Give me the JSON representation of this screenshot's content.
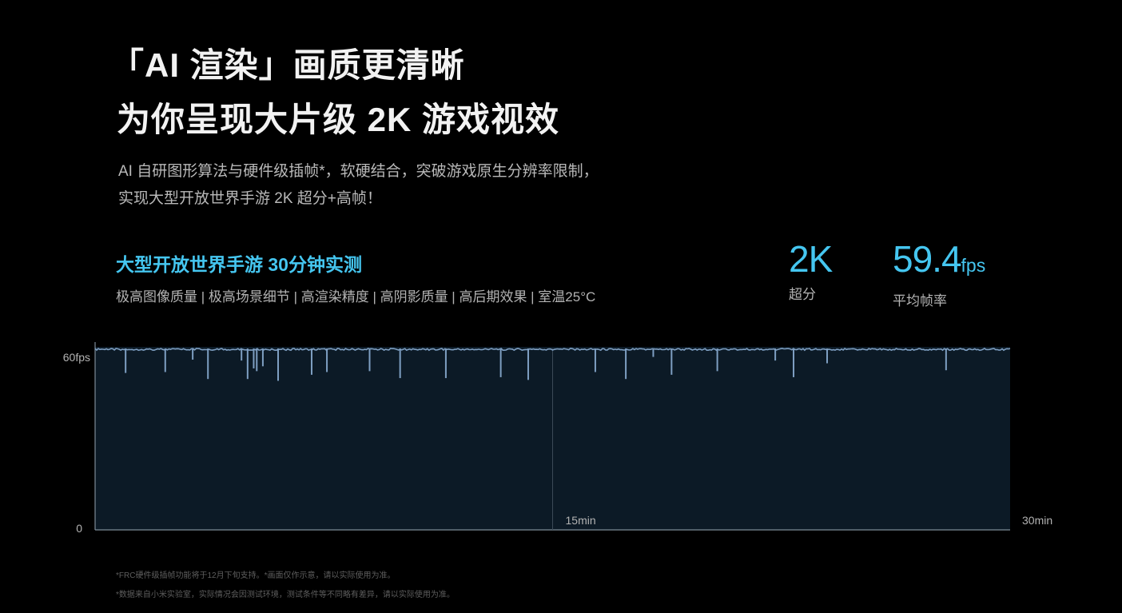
{
  "headline": {
    "line1": "「AI 渲染」画质更清晰",
    "line2": "为你呈现大片级 2K 游戏视效"
  },
  "subtitle": {
    "line1": "AI 自研图形算法与硬件级插帧*，软硬结合，突破游戏原生分辨率限制，",
    "line2": "实现大型开放世界手游 2K 超分+高帧！"
  },
  "test": {
    "title": "大型开放世界手游 30分钟实测",
    "settings": "极高图像质量 | 极高场景细节 | 高渲染精度 | 高阴影质量 | 高后期效果 | 室温25°C"
  },
  "stats": {
    "resolution": {
      "value": "2K",
      "label": "超分"
    },
    "fps": {
      "value": "59.4",
      "unit": "fps",
      "label": "平均帧率"
    }
  },
  "colors": {
    "accent": "#45c6f0",
    "plot_fill": "#0c1a26",
    "fps_line": "#7e9fc2"
  },
  "chart_data": {
    "type": "line",
    "xlabel": "",
    "ylabel": "",
    "x_range_min": [
      0,
      30
    ],
    "y_ticks": [
      "0",
      "60fps"
    ],
    "x_ticks": [
      {
        "value": 15,
        "label": "15min"
      },
      {
        "value": 30,
        "label": "30min"
      }
    ],
    "baseline_fps": 60,
    "dips": [
      {
        "t": 1.0,
        "fps": 51.9
      },
      {
        "t": 2.3,
        "fps": 52.2
      },
      {
        "t": 3.2,
        "fps": 56.3
      },
      {
        "t": 3.7,
        "fps": 49.9
      },
      {
        "t": 4.8,
        "fps": 56.0
      },
      {
        "t": 5.0,
        "fps": 49.9
      },
      {
        "t": 5.2,
        "fps": 53.4
      },
      {
        "t": 5.3,
        "fps": 52.5
      },
      {
        "t": 5.5,
        "fps": 54.1
      },
      {
        "t": 6.0,
        "fps": 49.3
      },
      {
        "t": 7.1,
        "fps": 51.3
      },
      {
        "t": 7.6,
        "fps": 52.2
      },
      {
        "t": 9.0,
        "fps": 52.5
      },
      {
        "t": 10.0,
        "fps": 50.2
      },
      {
        "t": 11.5,
        "fps": 50.2
      },
      {
        "t": 13.3,
        "fps": 50.5
      },
      {
        "t": 14.2,
        "fps": 56.6
      },
      {
        "t": 14.2,
        "fps": 49.6
      },
      {
        "t": 16.4,
        "fps": 52.2
      },
      {
        "t": 17.4,
        "fps": 49.9
      },
      {
        "t": 18.3,
        "fps": 57.2
      },
      {
        "t": 18.9,
        "fps": 51.3
      },
      {
        "t": 20.4,
        "fps": 52.5
      },
      {
        "t": 22.3,
        "fps": 56.0
      },
      {
        "t": 22.9,
        "fps": 50.5
      },
      {
        "t": 24.0,
        "fps": 55.1
      },
      {
        "t": 27.9,
        "fps": 52.8
      }
    ],
    "grid": false,
    "legend": "none"
  },
  "footnotes": [
    "*FRC硬件级插帧功能将于12月下旬支持。*画面仅作示意，请以实际使用为准。",
    "*数据来自小米实验室，实际情况会因测试环境，测试条件等不同略有差异，请以实际使用为准。"
  ]
}
